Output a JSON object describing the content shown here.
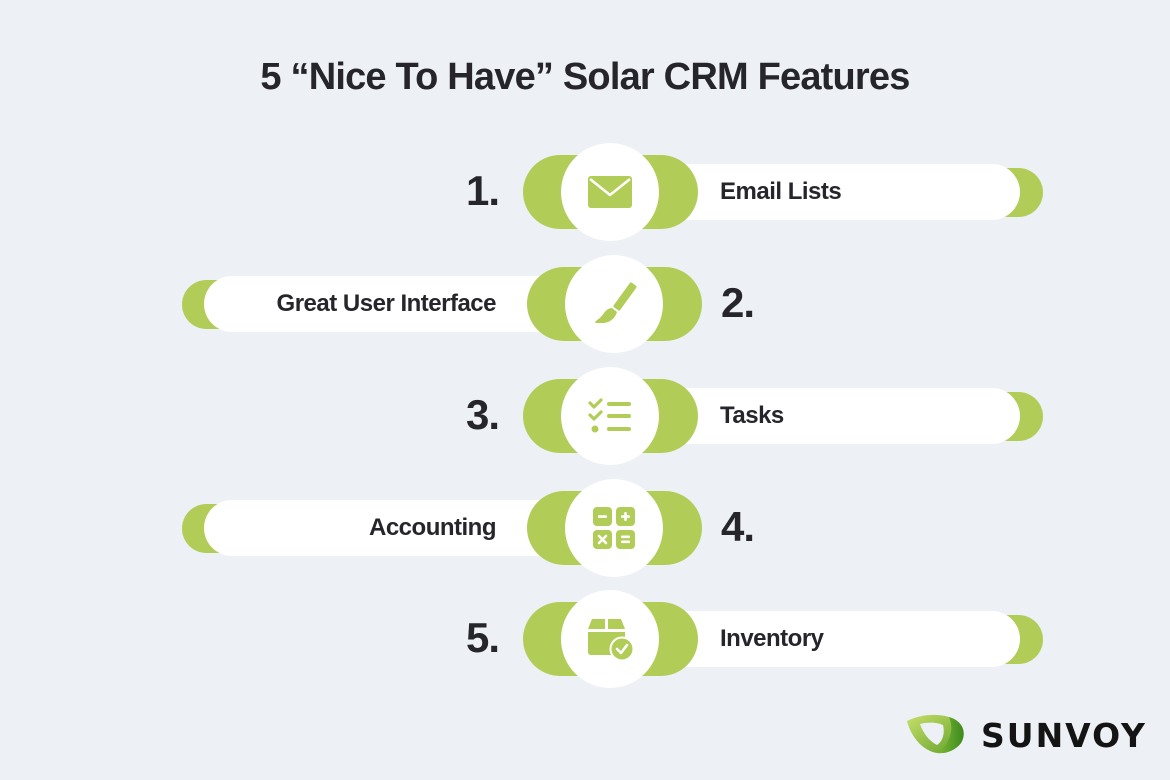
{
  "title": "5 “Nice To Have” Solar CRM Features",
  "colors": {
    "background": "#EDF0F5",
    "accent_green": "#B2CC58",
    "text": "#25252B",
    "card": "#FFFFFF"
  },
  "features": [
    {
      "number": "1.",
      "label": "Email Lists",
      "icon": "envelope-icon",
      "side": "right"
    },
    {
      "number": "2.",
      "label": "Great User Interface",
      "icon": "paintbrush-icon",
      "side": "left"
    },
    {
      "number": "3.",
      "label": "Tasks",
      "icon": "checklist-icon",
      "side": "right"
    },
    {
      "number": "4.",
      "label": "Accounting",
      "icon": "calculator-icon",
      "side": "left"
    },
    {
      "number": "5.",
      "label": "Inventory",
      "icon": "box-check-icon",
      "side": "right"
    }
  ],
  "brand": {
    "name": "SUNVOY",
    "logo_icon": "leaf-icon"
  }
}
